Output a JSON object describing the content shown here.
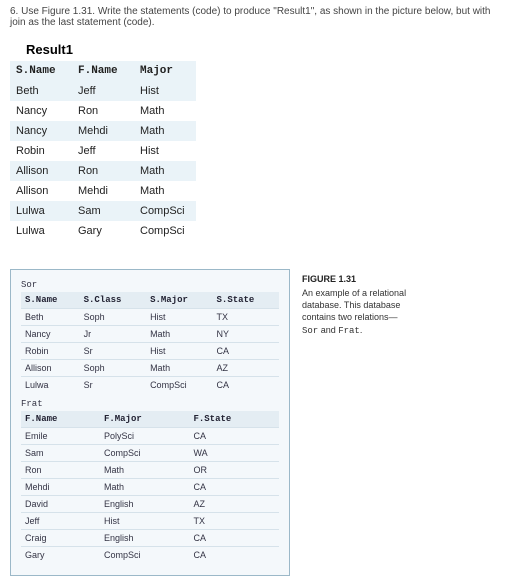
{
  "question": "6. Use Figure 1.31.  Write the statements (code) to produce \"Result1\", as shown in the picture below, but with join as the last statement (code).",
  "result_title": "Result1",
  "result_headers": [
    "S.Name",
    "F.Name",
    "Major"
  ],
  "result_rows": [
    [
      "Beth",
      "Jeff",
      "Hist"
    ],
    [
      "Nancy",
      "Ron",
      "Math"
    ],
    [
      "Nancy",
      "Mehdi",
      "Math"
    ],
    [
      "Robin",
      "Jeff",
      "Hist"
    ],
    [
      "Allison",
      "Ron",
      "Math"
    ],
    [
      "Allison",
      "Mehdi",
      "Math"
    ],
    [
      "Lulwa",
      "Sam",
      "CompSci"
    ],
    [
      "Lulwa",
      "Gary",
      "CompSci"
    ]
  ],
  "sor_label": "Sor",
  "sor_headers": [
    "S.Name",
    "S.Class",
    "S.Major",
    "S.State"
  ],
  "sor_rows": [
    [
      "Beth",
      "Soph",
      "Hist",
      "TX"
    ],
    [
      "Nancy",
      "Jr",
      "Math",
      "NY"
    ],
    [
      "Robin",
      "Sr",
      "Hist",
      "CA"
    ],
    [
      "Allison",
      "Soph",
      "Math",
      "AZ"
    ],
    [
      "Lulwa",
      "Sr",
      "CompSci",
      "CA"
    ]
  ],
  "frat_label": "Frat",
  "frat_headers": [
    "F.Name",
    "F.Major",
    "F.State"
  ],
  "frat_rows": [
    [
      "Emile",
      "PolySci",
      "CA"
    ],
    [
      "Sam",
      "CompSci",
      "WA"
    ],
    [
      "Ron",
      "Math",
      "OR"
    ],
    [
      "Mehdi",
      "Math",
      "CA"
    ],
    [
      "David",
      "English",
      "AZ"
    ],
    [
      "Jeff",
      "Hist",
      "TX"
    ],
    [
      "Craig",
      "English",
      "CA"
    ],
    [
      "Gary",
      "CompSci",
      "CA"
    ]
  ],
  "caption_title": "FIGURE 1.31",
  "caption_body_a": "An example of a relational database. This database contains two relations—",
  "caption_body_b": " and ",
  "caption_body_c": ".",
  "caption_code_a": "Sor",
  "caption_code_b": "Frat"
}
